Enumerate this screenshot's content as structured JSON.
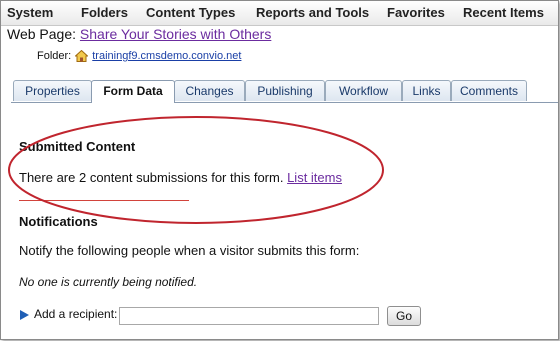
{
  "menu": [
    "System",
    "Folders",
    "Content Types",
    "Reports and Tools",
    "Favorites",
    "Recent Items"
  ],
  "page": {
    "label": "Web Page:",
    "title": "Share Your Stories with Others",
    "folder_label": "Folder:",
    "folder_link": "trainingf9.cmsdemo.convio.net"
  },
  "tabs": [
    {
      "label": "Properties",
      "active": false
    },
    {
      "label": "Form Data",
      "active": true
    },
    {
      "label": "Changes",
      "active": false
    },
    {
      "label": "Publishing",
      "active": false
    },
    {
      "label": "Workflow",
      "active": false
    },
    {
      "label": "Links",
      "active": false
    },
    {
      "label": "Comments",
      "active": false
    }
  ],
  "submitted": {
    "heading": "Submitted Content",
    "text": "There are 2 content submissions for this form.",
    "link": "List items"
  },
  "notifications": {
    "heading": "Notifications",
    "text": "Notify the following people when a visitor submits this form:",
    "empty_note": "No one is currently being notified.",
    "add_label": "Add a recipient:",
    "input_value": "",
    "go_label": "Go"
  },
  "colors": {
    "annotation_red": "#c0252e",
    "link_purple": "#6b2c9f",
    "arrow_blue": "#1f5fb5"
  }
}
